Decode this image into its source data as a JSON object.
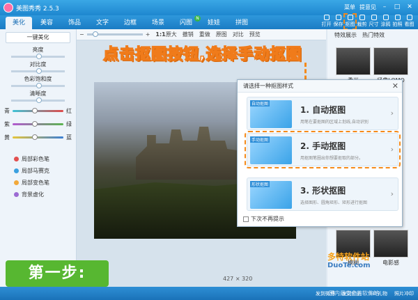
{
  "app": {
    "title": "美图秀秀 2.5.3",
    "menu": "菜单",
    "feedback": "提意见"
  },
  "tabs": [
    "美化",
    "美容",
    "饰品",
    "文字",
    "边框",
    "场景",
    "闪图",
    "娃娃",
    "拼图"
  ],
  "active_tab": "美化",
  "toolbar_right": [
    "打开",
    "保存",
    "抠图",
    "裁剪",
    "尺寸",
    "涂鸦",
    "拍照",
    "看图"
  ],
  "highlight_tool": "抠图",
  "toolbar2": {
    "ratio": "1:1",
    "ratio_label": "原大",
    "undo": "撤销",
    "redo": "重做",
    "original": "原图",
    "compare": "对比",
    "preview": "预览"
  },
  "effects_header": {
    "left": "特效展示",
    "right": "热门特效"
  },
  "left_panel": {
    "one_key": "一键美化",
    "adjustments": [
      "亮度",
      "对比度",
      "色彩饱和度",
      "清晰度"
    ],
    "color_rows": [
      {
        "left": "青",
        "right": "红",
        "color": "#e04b4b"
      },
      {
        "left": "紫",
        "right": "绿",
        "color": "#5bb550"
      },
      {
        "left": "黄",
        "right": "蓝",
        "color": "#3b7fd4"
      }
    ],
    "brushes": [
      "局部彩色笔",
      "局部马赛克",
      "局部变色笔",
      "背景虚化"
    ]
  },
  "instruction": "点击抠图按钮,选择手动抠图",
  "image_size": "427 × 320",
  "effects": [
    "柔光",
    "经典LOMO",
    "暖化",
    "迷离",
    "模糊",
    "电影感"
  ],
  "dialog": {
    "title": "请选择一种抠图样式",
    "options": [
      {
        "tag": "自动抠图",
        "title": "1. 自动抠图",
        "desc": "用笔在要抠图的区域上划线,自动识别"
      },
      {
        "tag": "手动抠图",
        "title": "2. 手动抠图",
        "desc": "用抠图笔圈出你想要抠取的部分。"
      },
      {
        "tag": "形状抠图",
        "title": "3. 形状抠图",
        "desc": "选择图形、圆角矩形、矩形进行抠图"
      }
    ],
    "dont_show": "下次不再提示"
  },
  "step_label": "第一步:",
  "statusbar": [
    "发到微博",
    "发到相册",
    "33T礼物",
    "照片冲印"
  ],
  "watermark": {
    "brand": "多特软件站",
    "site": "DuoTe.com",
    "slogan": "国内最安全的软件站"
  }
}
